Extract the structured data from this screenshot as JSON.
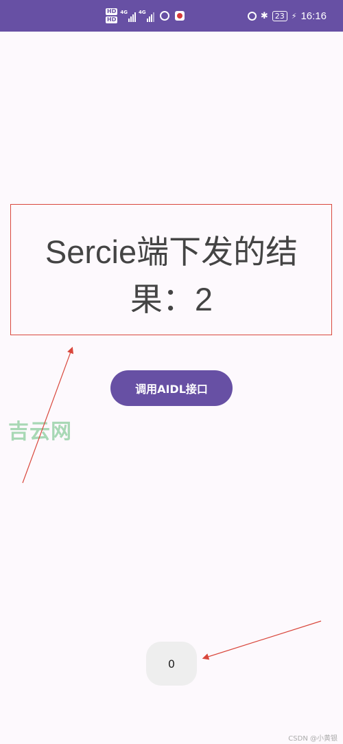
{
  "status_bar": {
    "hd_top": "HD",
    "hd_bottom": "HD",
    "net1": "4G",
    "net2": "4G",
    "battery": "23",
    "time": "16:16"
  },
  "main": {
    "result_text": "Sercie端下发的结果：2",
    "aidl_button_label": "调用AIDL接口",
    "counter_value": "0"
  },
  "watermark": "吉云网",
  "footer": "CSDN @小黄银",
  "colors": {
    "accent": "#6750a4",
    "annotation": "#d9473c",
    "background": "#fdf9fd"
  }
}
